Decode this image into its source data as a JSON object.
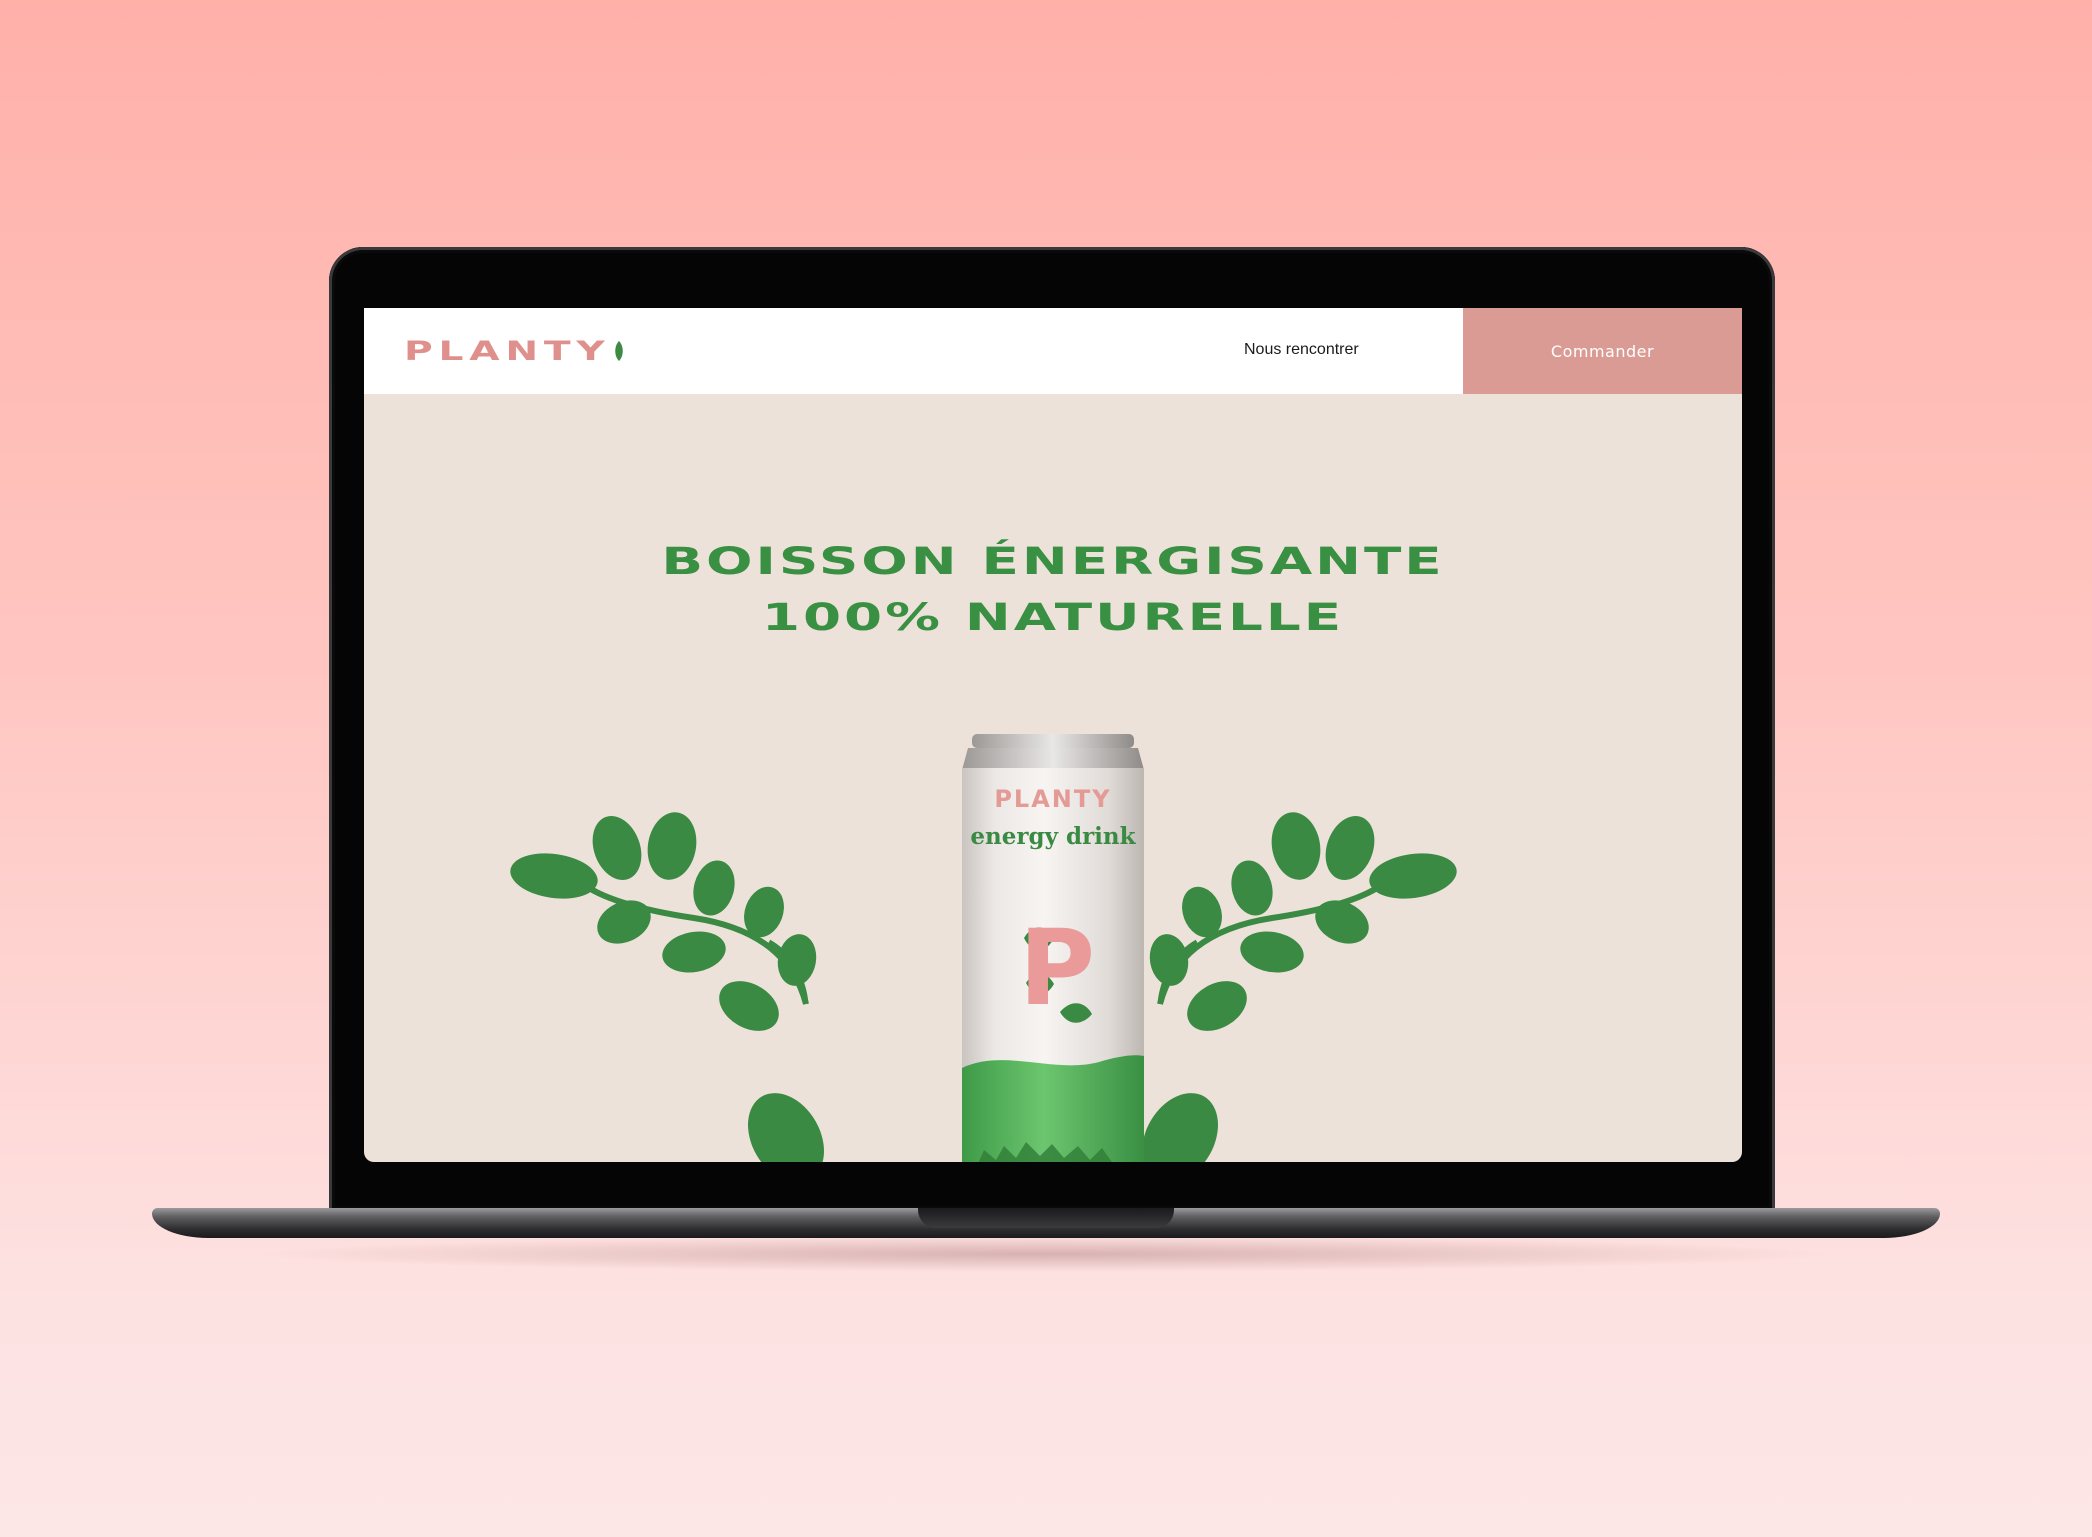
{
  "site": {
    "brand": "PLANTY",
    "nav": {
      "link_label": "Nous rencontrer",
      "cta_label": "Commander"
    },
    "hero": {
      "title_line1": "BOISSON ÉNERGISANTE",
      "title_line2": "100% NATURELLE"
    },
    "product_can": {
      "brand": "PLANTY",
      "subtitle": "energy drink",
      "monogram": "P"
    }
  },
  "colors": {
    "page_background": "#ffb0a9",
    "site_background": "#ede2d9",
    "brand_pink": "#e0908c",
    "button_pink": "#da9b94",
    "brand_green": "#399043",
    "leaf_green": "#3a8a44"
  },
  "icons": {
    "logo_leaf": "leaf-icon",
    "branch_left": "leaf-branch-left",
    "branch_right": "leaf-branch-right"
  }
}
